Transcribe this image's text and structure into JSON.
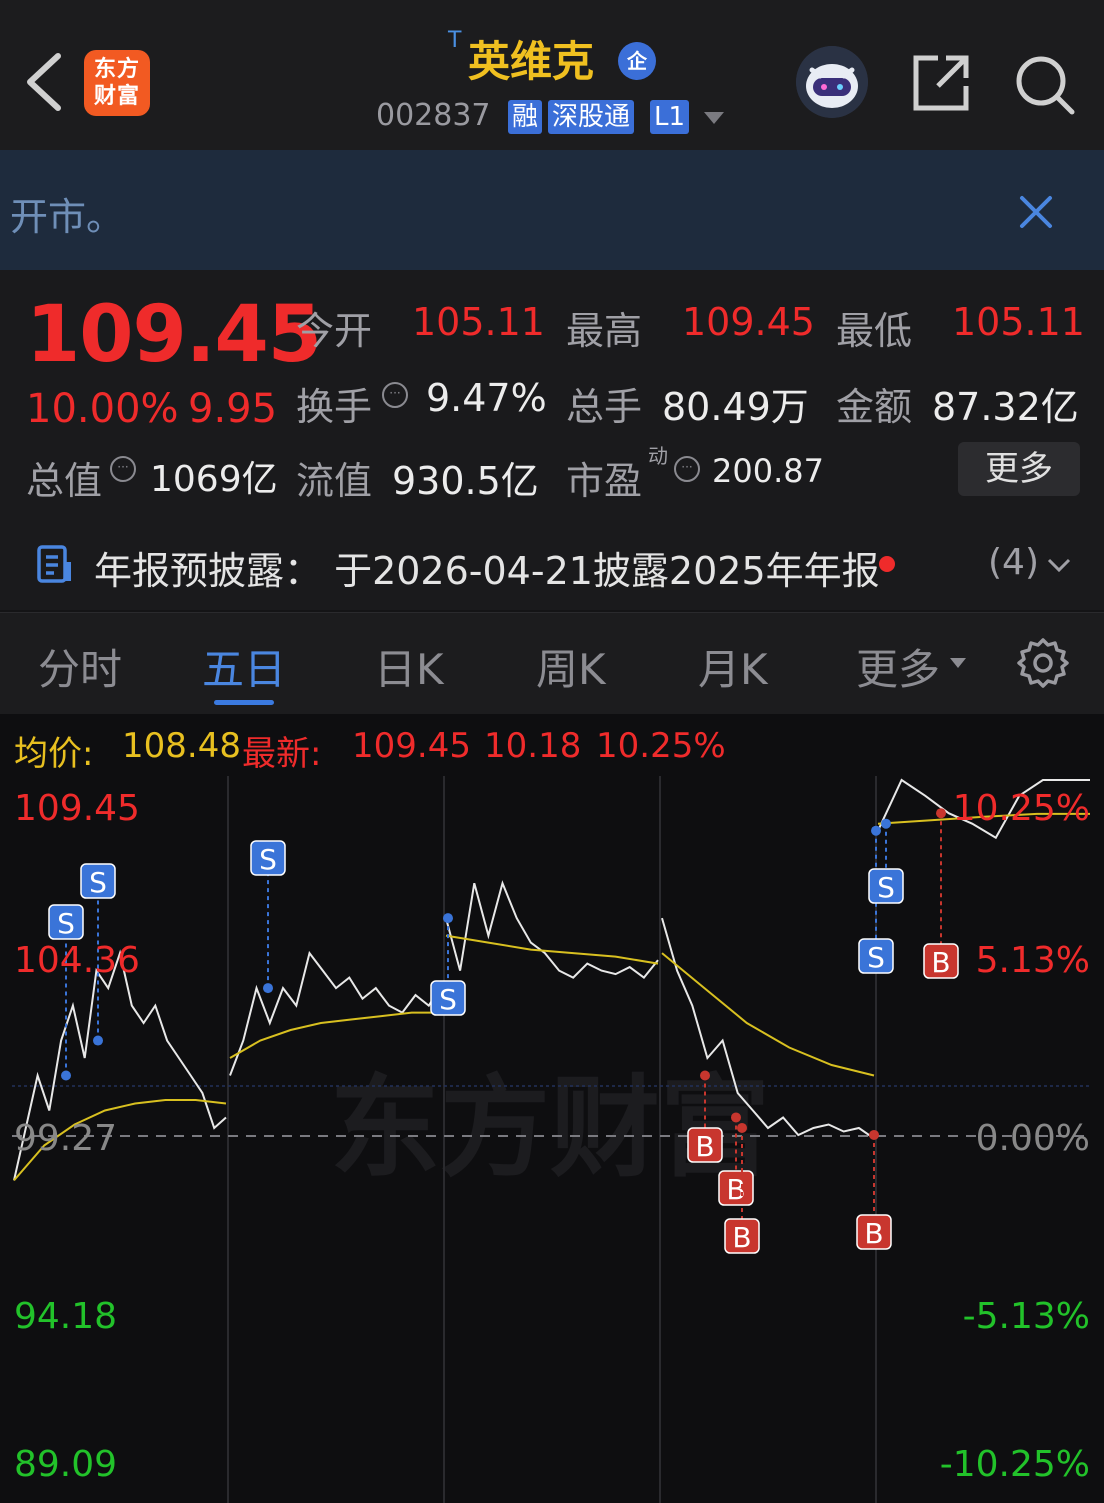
{
  "header": {
    "logo_text": "东方财富",
    "title_prefix": "T",
    "title": "英维克",
    "qi_badge": "企",
    "code": "002837",
    "tags": [
      "融",
      "深股通",
      "L1"
    ]
  },
  "notice": {
    "text": "开市。"
  },
  "quote": {
    "price": "109.45",
    "change_pct": "10.00%",
    "change_amt": "9.95",
    "open_label": "今开",
    "open": "105.11",
    "high_label": "最高",
    "high": "109.45",
    "low_label": "最低",
    "low": "105.11",
    "turnover_label": "换手",
    "turnover": "9.47%",
    "volume_label": "总手",
    "volume": "80.49万",
    "amount_label": "金额",
    "amount": "87.32亿",
    "mcap_label": "总值",
    "mcap": "1069亿",
    "float_label": "流值",
    "float": "930.5亿",
    "pe_label": "市盈",
    "pe_sup": "动",
    "pe": "200.87",
    "more_label": "更多"
  },
  "report": {
    "text": "年报预披露：  于2026-04-21披露2025年年报",
    "count": "(4)"
  },
  "tabs": [
    "分时",
    "五日",
    "日K",
    "周K",
    "月K",
    "更多"
  ],
  "active_tab": "五日",
  "chart_info": {
    "avg_label": "均价:",
    "avg": "108.48",
    "latest_label": "最新:",
    "latest": "109.45",
    "change": "10.18",
    "change_pct": "10.25%"
  },
  "chart_data": {
    "type": "line",
    "y_left_ticks": [
      "109.45",
      "104.36",
      "99.27",
      "94.18",
      "89.09"
    ],
    "y_right_ticks": [
      "10.25%",
      "5.13%",
      "0.00%",
      "-5.13%",
      "-10.25%"
    ],
    "ylim": [
      89.09,
      109.45
    ],
    "days": 5,
    "watermark": "东方财富",
    "colors": {
      "price": "#e8e8e8",
      "avg": "#d8c020",
      "up": "#ef2b2b",
      "down": "#22c22a",
      "sell": "#3a74d8",
      "buy": "#c8362e"
    }
  },
  "colors": {
    "accent": "#3b7ae0",
    "up": "#ef2b2b",
    "title": "#f0c020"
  }
}
